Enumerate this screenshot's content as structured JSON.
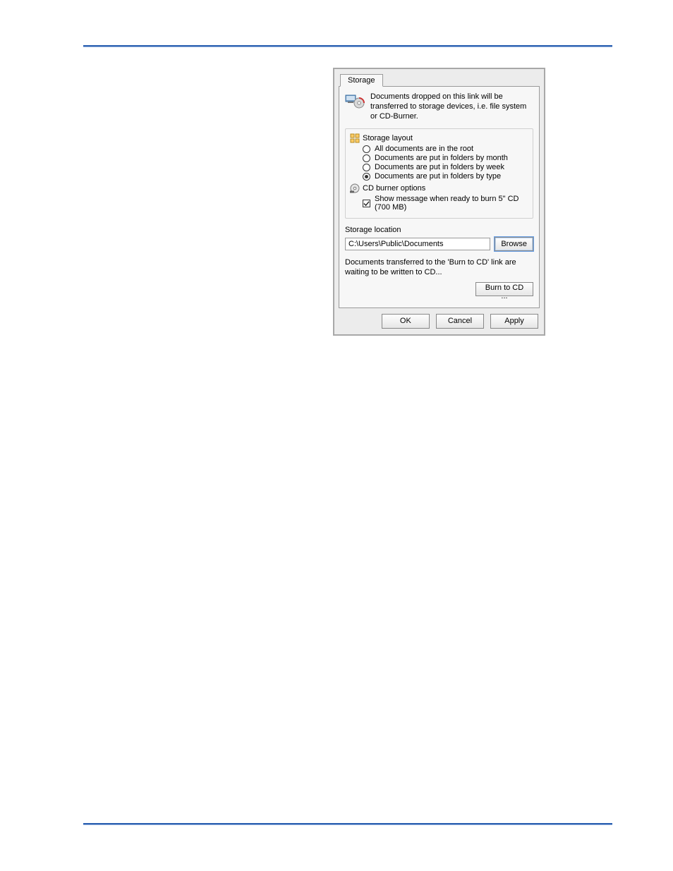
{
  "dialog": {
    "tab_label": "Storage",
    "intro": "Documents dropped on this link will be transferred to storage devices, i.e. file system or CD-Burner.",
    "storage_layout": {
      "heading": "Storage layout",
      "options": [
        "All documents are in the root",
        "Documents are put in folders by month",
        "Documents are put in folders by week",
        "Documents are put in folders by type"
      ],
      "selected_index": 3
    },
    "cd_burner": {
      "heading": "CD burner options",
      "checkbox_label": "Show message when ready to burn 5\" CD (700 MB)",
      "checked": true
    },
    "location": {
      "label": "Storage location",
      "path": "C:\\Users\\Public\\Documents",
      "browse_label": "Browse"
    },
    "burn": {
      "text": "Documents transferred to the 'Burn to CD' link are waiting to be written to CD...",
      "button_label": "Burn to CD ..."
    },
    "buttons": {
      "ok": "OK",
      "cancel": "Cancel",
      "apply": "Apply"
    }
  }
}
